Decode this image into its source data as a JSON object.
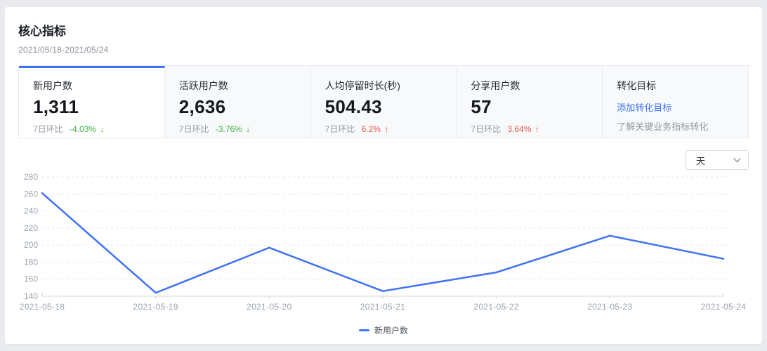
{
  "page": {
    "background": "#e9ebee",
    "accent_color": "#3e73f5"
  },
  "header": {
    "title": "核心指标",
    "date_range": "2021/05/18-2021/05/24"
  },
  "metric_tabs": [
    {
      "label": "新用户数",
      "value": "1,311",
      "compare_label": "7日环比",
      "change": "-4.03%",
      "arrow": "↓",
      "direction": "down",
      "change_color": "#3eb044",
      "selected": true
    },
    {
      "label": "活跃用户数",
      "value": "2,636",
      "compare_label": "7日环比",
      "change": "-3.76%",
      "arrow": "↓",
      "direction": "down",
      "change_color": "#3eb044",
      "selected": false
    },
    {
      "label": "人均停留时长(秒)",
      "value": "504.43",
      "compare_label": "7日环比",
      "change": "6.2%",
      "arrow": "↑",
      "direction": "up",
      "change_color": "#ea5446",
      "selected": false
    },
    {
      "label": "分享用户数",
      "value": "57",
      "compare_label": "7日环比",
      "change": "3.64%",
      "arrow": "↑",
      "direction": "up",
      "change_color": "#ea5446",
      "selected": false
    }
  ],
  "goal_card": {
    "title": "转化目标",
    "link_label": "添加转化目标",
    "description": "了解关键业务指标转化"
  },
  "granularity_select": {
    "value": "天"
  },
  "chart_data": {
    "type": "line",
    "categories": [
      "2021-05-18",
      "2021-05-19",
      "2021-05-20",
      "2021-05-21",
      "2021-05-22",
      "2021-05-23",
      "2021-05-24"
    ],
    "series": [
      {
        "name": "新用户数",
        "values": [
          261,
          144,
          197,
          146,
          168,
          211,
          184
        ],
        "color": "#3e73f5"
      }
    ],
    "ylim": [
      140,
      280
    ],
    "ytick_step": 20,
    "xlabel": "",
    "ylabel": "",
    "grid": "horizontal-dashed",
    "legend_position": "bottom",
    "axis_text_color": "#9ba3ad",
    "grid_color": "#e6e6e6",
    "axis_line_color": "#d4d7dc"
  }
}
